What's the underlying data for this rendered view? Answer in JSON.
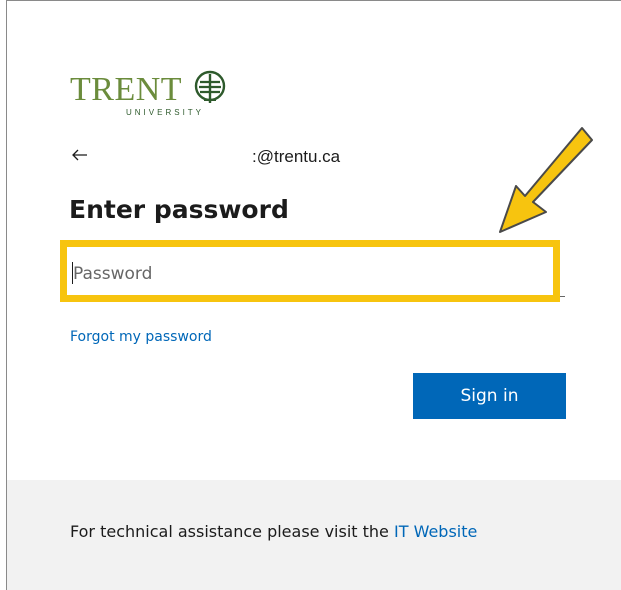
{
  "logo": {
    "wordmark": "TRENT",
    "subtitle": "UNIVERSITY",
    "mark_icon": "trent-crest-icon"
  },
  "identity": {
    "back_icon": "back-arrow-icon",
    "email": ":@trentu.ca"
  },
  "page": {
    "title": "Enter password"
  },
  "password": {
    "placeholder": "Password",
    "value": ""
  },
  "links": {
    "forgot_password": "Forgot my password"
  },
  "actions": {
    "sign_in_label": "Sign in"
  },
  "footer": {
    "text": "For technical assistance please visit the ",
    "link_text": "IT Website"
  },
  "annotation": {
    "highlight_color": "#f7c40f",
    "arrow_icon": "yellow-arrow-icon"
  },
  "colors": {
    "accent": "#0067b8",
    "brand_green": "#6b8c3c",
    "footer_bg": "#f2f2f2"
  }
}
